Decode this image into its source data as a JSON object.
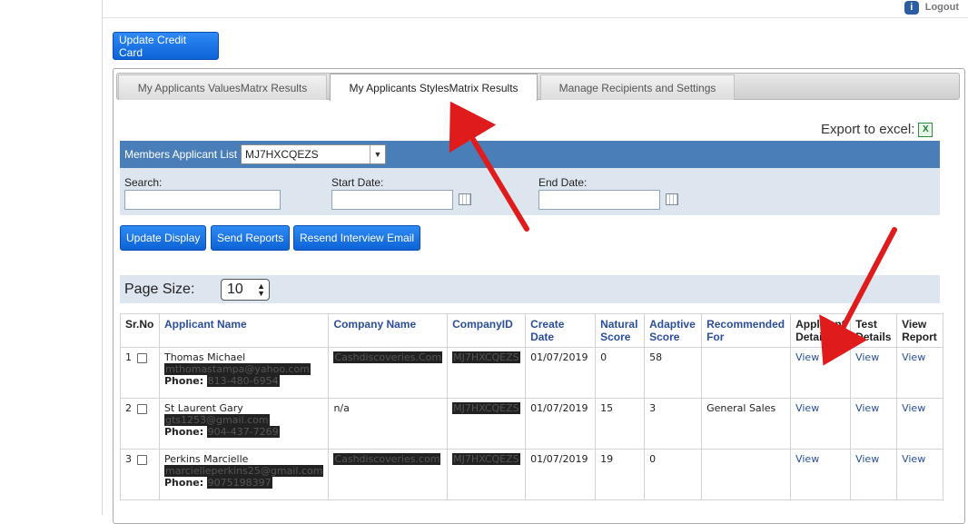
{
  "header": {
    "logout_label": "Logout",
    "logout_icon": "info-icon"
  },
  "update_credit_card_label": "Update Credit Card",
  "tabs": [
    {
      "label": "My Applicants ValuesMatrx Results",
      "active": false
    },
    {
      "label": "My Applicants StylesMatrix Results",
      "active": true
    },
    {
      "label": "Manage Recipients and Settings",
      "active": false
    }
  ],
  "export_label": "Export to excel:",
  "filter": {
    "members_label": "Members Applicant List",
    "members_selected": "MJ7HXCQEZS",
    "search_label": "Search:",
    "start_date_label": "Start Date:",
    "end_date_label": "End Date:",
    "search_value": "",
    "start_date_value": "",
    "end_date_value": ""
  },
  "actions": {
    "update_display": "Update Display",
    "send_reports": "Send Reports",
    "resend_email": "Resend Interview Email"
  },
  "page_size": {
    "label": "Page Size:",
    "value": "10"
  },
  "table": {
    "headers": {
      "srno": "Sr.No",
      "name": "Applicant Name",
      "company": "Company Name",
      "companyid": "CompanyID",
      "create1": "Create",
      "create2": "Date",
      "natural1": "Natural",
      "natural2": "Score",
      "adaptive1": "Adaptive",
      "adaptive2": "Score",
      "rec1": "Recommended",
      "rec2": "For",
      "appdet1": "Applicant",
      "appdet2": "Details",
      "testdet1": "Test",
      "testdet2": "Details",
      "view1": "View",
      "view2": "Report"
    },
    "phone_label": "Phone:",
    "rows": [
      {
        "n": "1",
        "name": "Thomas Michael",
        "email": "mthomastampa@yahoo.com",
        "phone": "813-480-6954",
        "company": "Cashdiscoveries.Com",
        "companyid": "MJ7HXCQEZS",
        "date": "01/07/2019",
        "natural": "0",
        "adaptive": "58",
        "rec": "",
        "v1": "View",
        "v2": "View",
        "v3": "View"
      },
      {
        "n": "2",
        "name": "St Laurent Gary",
        "email": "gts1253@gmail.com",
        "phone": "904-437-7269",
        "company": "n/a",
        "companyid": "MJ7HXCQEZS",
        "date": "01/07/2019",
        "natural": "15",
        "adaptive": "3",
        "rec": "General Sales",
        "v1": "View",
        "v2": "View",
        "v3": "View"
      },
      {
        "n": "3",
        "name": "Perkins Marcielle",
        "email": "marcielleperkins25@gmail.com",
        "phone": "9075198397",
        "company": "Cashdiscoveries.com",
        "companyid": "MJ7HXCQEZS",
        "date": "01/07/2019",
        "natural": "19",
        "adaptive": "0",
        "rec": "",
        "v1": "View",
        "v2": "View",
        "v3": "View"
      }
    ]
  },
  "colors": {
    "link": "#2b4e9c",
    "button": "#0d63d6",
    "filter_bar": "#4a7eb8",
    "arrow": "#e01b1b"
  }
}
